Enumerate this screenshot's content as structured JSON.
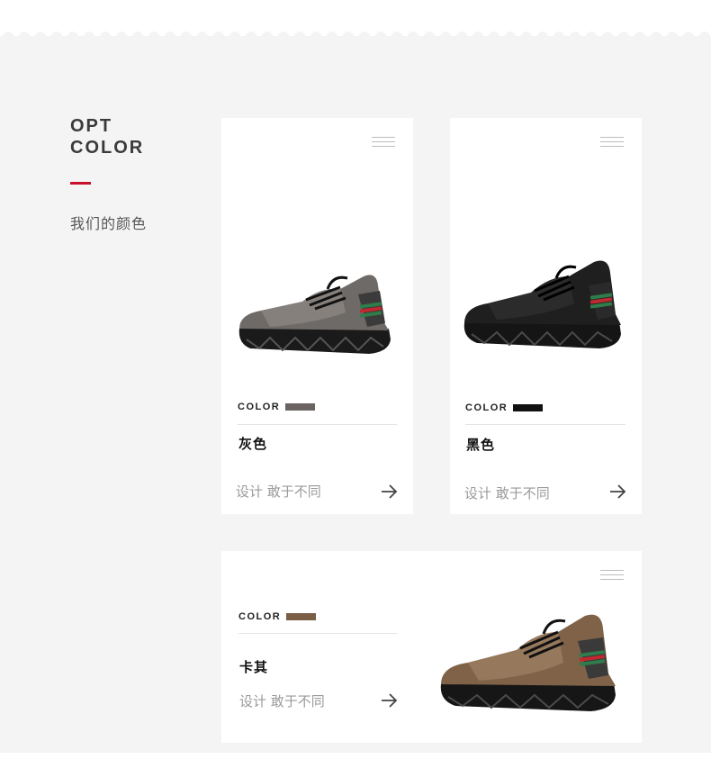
{
  "section": {
    "heading_line1": "OPT",
    "heading_line2": "COLOR",
    "subtitle": "我们的颜色",
    "accent": "#c8102e"
  },
  "cards": [
    {
      "color_label": "COLOR",
      "name": "灰色",
      "swatch": "#6b6262",
      "slogan": "设计 敢于不同",
      "icon": "arrow-right-icon"
    },
    {
      "color_label": "COLOR",
      "name": "黑色",
      "swatch": "#111111",
      "slogan": "设计 敢于不同",
      "icon": "arrow-right-icon"
    },
    {
      "color_label": "COLOR",
      "name": "卡其",
      "swatch": "#7a5e45",
      "slogan": "设计 敢于不同",
      "icon": "arrow-right-icon"
    }
  ]
}
